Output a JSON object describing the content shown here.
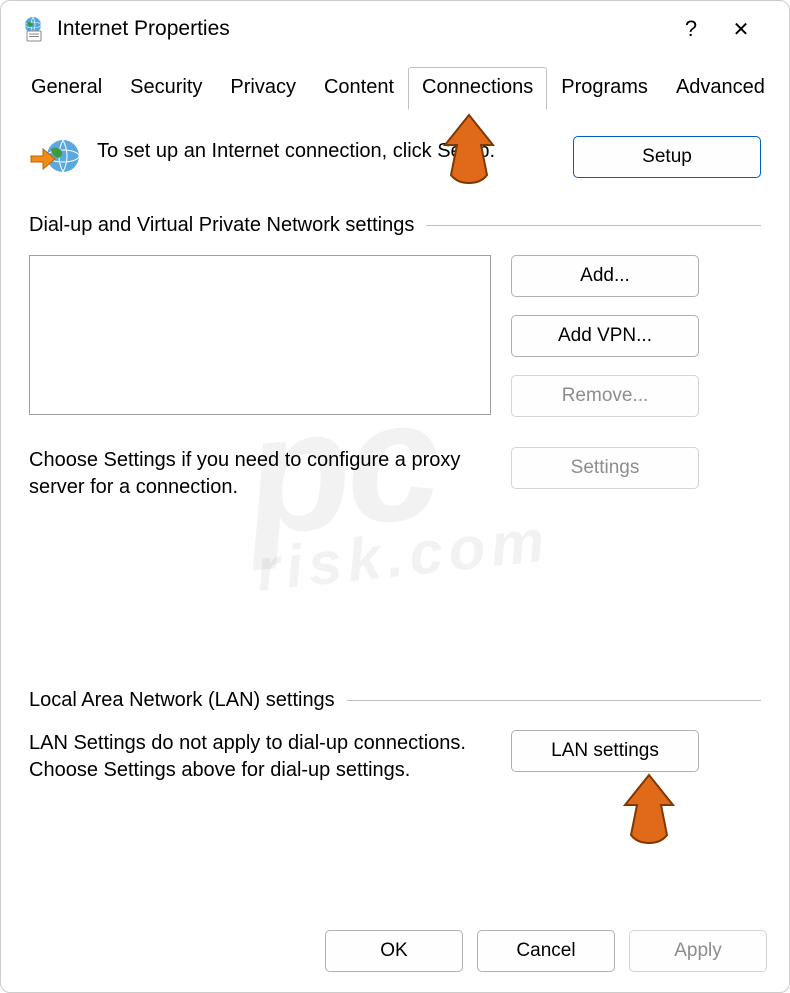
{
  "window": {
    "title": "Internet Properties",
    "help_glyph": "?",
    "close_glyph": "✕"
  },
  "tabs": [
    {
      "label": "General",
      "active": false
    },
    {
      "label": "Security",
      "active": false
    },
    {
      "label": "Privacy",
      "active": false
    },
    {
      "label": "Content",
      "active": false
    },
    {
      "label": "Connections",
      "active": true
    },
    {
      "label": "Programs",
      "active": false
    },
    {
      "label": "Advanced",
      "active": false
    }
  ],
  "intro": {
    "text": "To set up an Internet connection, click Setup.",
    "setup_button": "Setup"
  },
  "dialup": {
    "group_label": "Dial-up and Virtual Private Network settings",
    "add_button": "Add...",
    "add_vpn_button": "Add VPN...",
    "remove_button": "Remove...",
    "settings_button": "Settings",
    "hint_text": "Choose Settings if you need to configure a proxy server for a connection."
  },
  "lan": {
    "group_label": "Local Area Network (LAN) settings",
    "text": "LAN Settings do not apply to dial-up connections. Choose Settings above for dial-up settings.",
    "button": "LAN settings"
  },
  "footer": {
    "ok": "OK",
    "cancel": "Cancel",
    "apply": "Apply"
  },
  "watermark": {
    "main": "pc",
    "sub": "risk.com"
  }
}
